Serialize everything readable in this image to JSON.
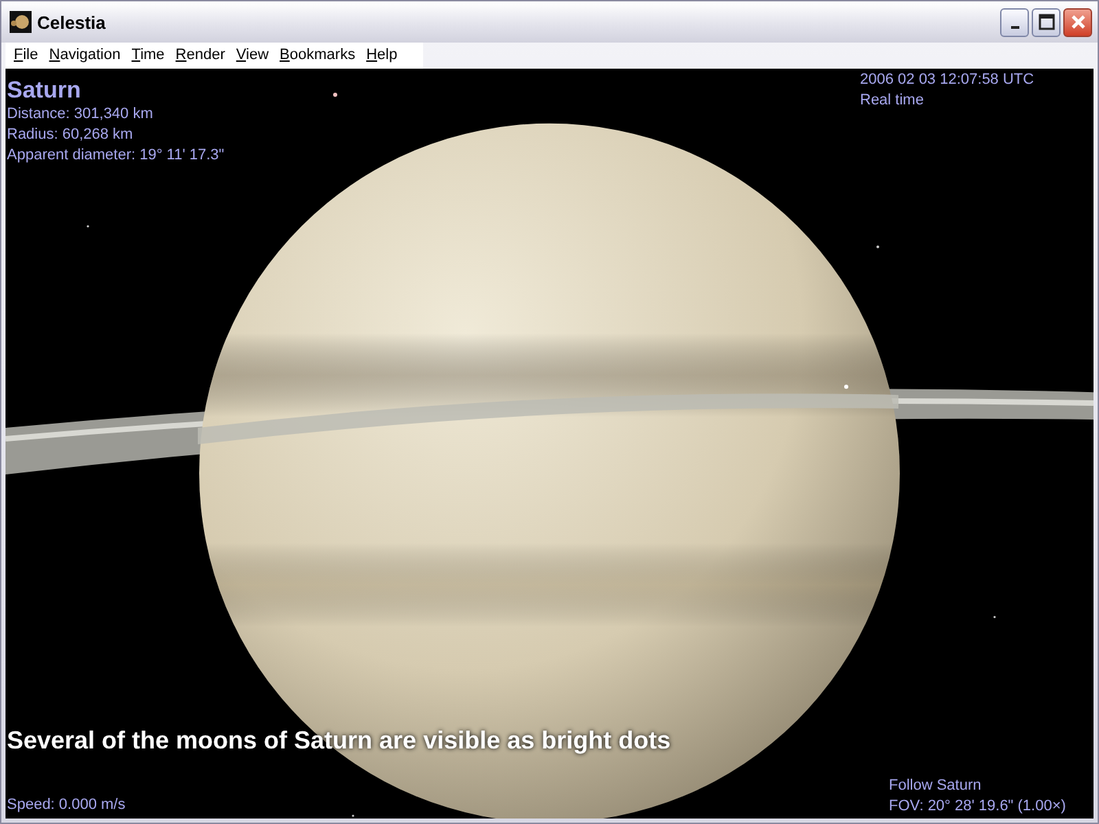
{
  "window": {
    "title": "Celestia"
  },
  "menu": [
    {
      "label": "File"
    },
    {
      "label": "Navigation"
    },
    {
      "label": "Time"
    },
    {
      "label": "Render"
    },
    {
      "label": "View"
    },
    {
      "label": "Bookmarks"
    },
    {
      "label": "Help"
    }
  ],
  "info": {
    "name": "Saturn",
    "lines": [
      "Distance: 301,340 km",
      "Radius: 60,268 km",
      "Apparent diameter: 19° 11' 17.3\""
    ]
  },
  "time": {
    "date": "2006 02 03 12:07:58 UTC",
    "mode": "Real time"
  },
  "caption": "Several of the moons of Saturn are visible as bright dots",
  "speed": "Speed: 0.000 m/s",
  "view": {
    "follow": "Follow Saturn",
    "fov": "FOV: 20° 28' 19.6\" (1.00×)"
  }
}
